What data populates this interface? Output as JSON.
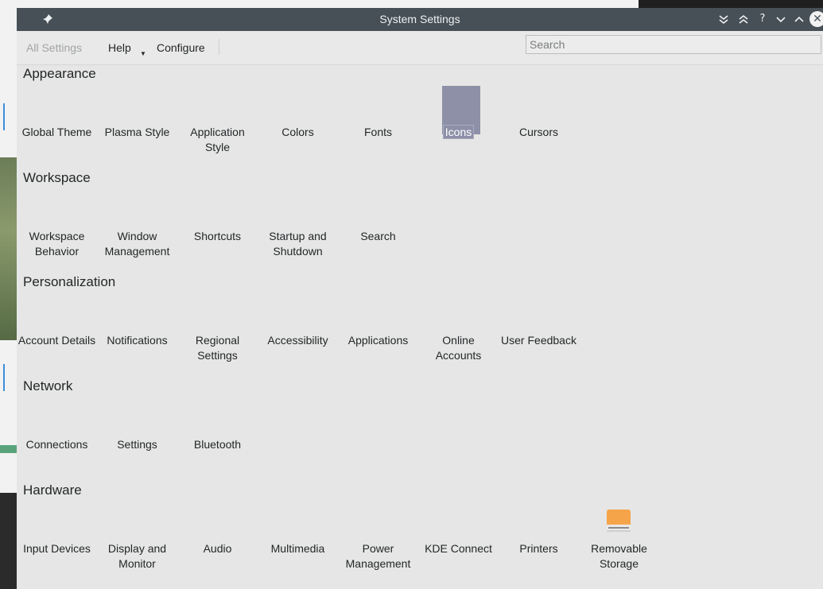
{
  "window": {
    "title": "System Settings",
    "controls": [
      "keep-below-icon",
      "keep-above-icon",
      "help-icon",
      "minimize-icon",
      "maximize-icon",
      "close-icon"
    ]
  },
  "toolbar": {
    "all_settings_label": "All Settings",
    "help_label": "Help",
    "configure_label": "Configure",
    "search_placeholder": "Search"
  },
  "colors": {
    "titlebar": "#475057",
    "background": "#e6e6e6",
    "selection": "#8e90a8",
    "storage_icon": "#f6a44a"
  },
  "sections": [
    {
      "title": "Appearance",
      "items": [
        "Global Theme",
        "Plasma Style",
        "Application Style",
        "Colors",
        "Fonts",
        "Icons",
        "Cursors"
      ],
      "selected": "Icons"
    },
    {
      "title": "Workspace",
      "items": [
        "Workspace Behavior",
        "Window Management",
        "Shortcuts",
        "Startup and Shutdown",
        "Search"
      ]
    },
    {
      "title": "Personalization",
      "items": [
        "Account Details",
        "Notifications",
        "Regional Settings",
        "Accessibility",
        "Applications",
        "Online Accounts",
        "User Feedback"
      ]
    },
    {
      "title": "Network",
      "items": [
        "Connections",
        "Settings",
        "Bluetooth"
      ]
    },
    {
      "title": "Hardware",
      "items": [
        "Input Devices",
        "Display and Monitor",
        "Audio",
        "Multimedia",
        "Power Management",
        "KDE Connect",
        "Printers",
        "Removable Storage"
      ]
    }
  ]
}
